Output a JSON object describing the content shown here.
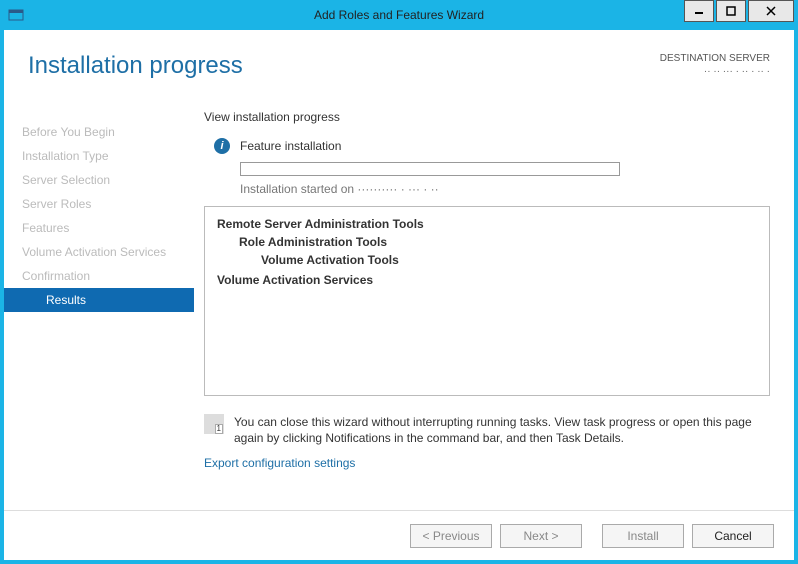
{
  "window": {
    "title": "Add Roles and Features Wizard"
  },
  "header": {
    "page_title": "Installation progress",
    "destination_label": "DESTINATION SERVER",
    "destination_value": "·· ·· ··· · ·· · ·· ·"
  },
  "sidebar": {
    "items": [
      {
        "label": "Before You Begin",
        "active": false
      },
      {
        "label": "Installation Type",
        "active": false
      },
      {
        "label": "Server Selection",
        "active": false
      },
      {
        "label": "Server Roles",
        "active": false
      },
      {
        "label": "Features",
        "active": false
      },
      {
        "label": "Volume Activation Services",
        "active": false
      },
      {
        "label": "Confirmation",
        "active": false
      },
      {
        "label": "Results",
        "active": true
      }
    ]
  },
  "main": {
    "section_label": "View installation progress",
    "feature_line": "Feature installation",
    "started_text": "Installation started on ·········· · ··· · ··",
    "results": {
      "line0": "Remote Server Administration Tools",
      "line1": "Role Administration Tools",
      "line2": "Volume Activation Tools",
      "line3": "Volume Activation Services"
    },
    "hint_text": "You can close this wizard without interrupting running tasks. View task progress or open this page again by clicking Notifications in the command bar, and then Task Details.",
    "export_link": "Export configuration settings"
  },
  "footer": {
    "previous": "< Previous",
    "next": "Next >",
    "install": "Install",
    "cancel": "Cancel"
  }
}
